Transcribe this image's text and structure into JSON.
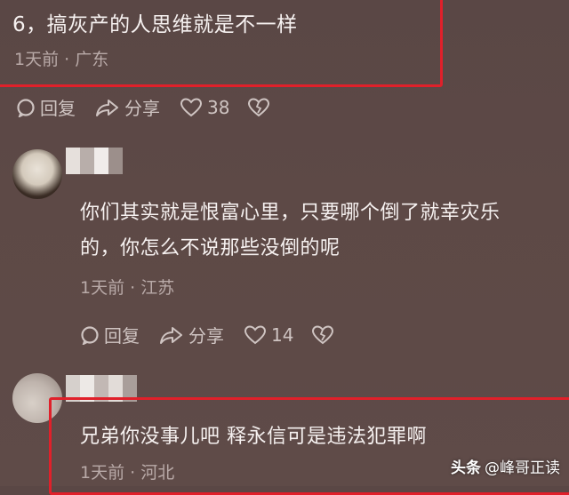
{
  "comment1": {
    "text": "6，搞灰产的人思维就是不一样",
    "meta": "1天前 · 广东",
    "actions": {
      "reply": "回复",
      "share": "分享",
      "likes": "38"
    }
  },
  "comment2": {
    "line1": "你们其实就是恨富心里，只要哪个倒了就幸灾乐",
    "line2": "的，你怎么不说那些没倒的呢",
    "meta": "1天前 · 江苏",
    "actions": {
      "reply": "回复",
      "share": "分享",
      "likes": "14"
    }
  },
  "comment3": {
    "text": "兄弟你没事儿吧 释永信可是违法犯罪啊",
    "meta": "1天前 · 河北"
  },
  "watermark": {
    "brand": "头条",
    "handle": "@峰哥正读"
  },
  "colors": {
    "highlight_border": "#e0202a",
    "background": "#5d4946"
  },
  "icons": [
    "reply-icon",
    "share-icon",
    "heart-icon",
    "broken-heart-icon"
  ]
}
